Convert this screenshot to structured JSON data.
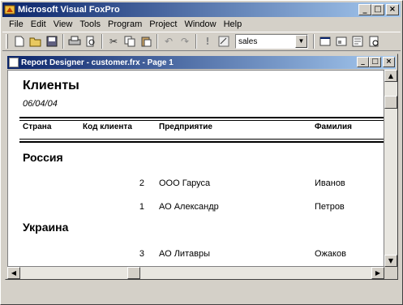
{
  "app": {
    "title": "Microsoft Visual FoxPro"
  },
  "menu": [
    "File",
    "Edit",
    "View",
    "Tools",
    "Program",
    "Project",
    "Window",
    "Help"
  ],
  "toolbar": {
    "combo_value": "sales"
  },
  "child": {
    "title": "Report Designer - customer.frx - Page 1"
  },
  "report": {
    "title": "Клиенты",
    "date": "06/04/04",
    "headers": {
      "country": "Страна",
      "code": "Код клиента",
      "company": "Предприятие",
      "lastname": "Фамилия"
    },
    "groups": [
      {
        "name": "Россия",
        "rows": [
          {
            "code": "2",
            "company": "ООО Гаруса",
            "lastname": "Иванов"
          },
          {
            "code": "1",
            "company": "АО Александр",
            "lastname": "Петров"
          }
        ]
      },
      {
        "name": "Украина",
        "rows": [
          {
            "code": "3",
            "company": "АО Литавры",
            "lastname": "Ожаков"
          }
        ]
      }
    ]
  }
}
